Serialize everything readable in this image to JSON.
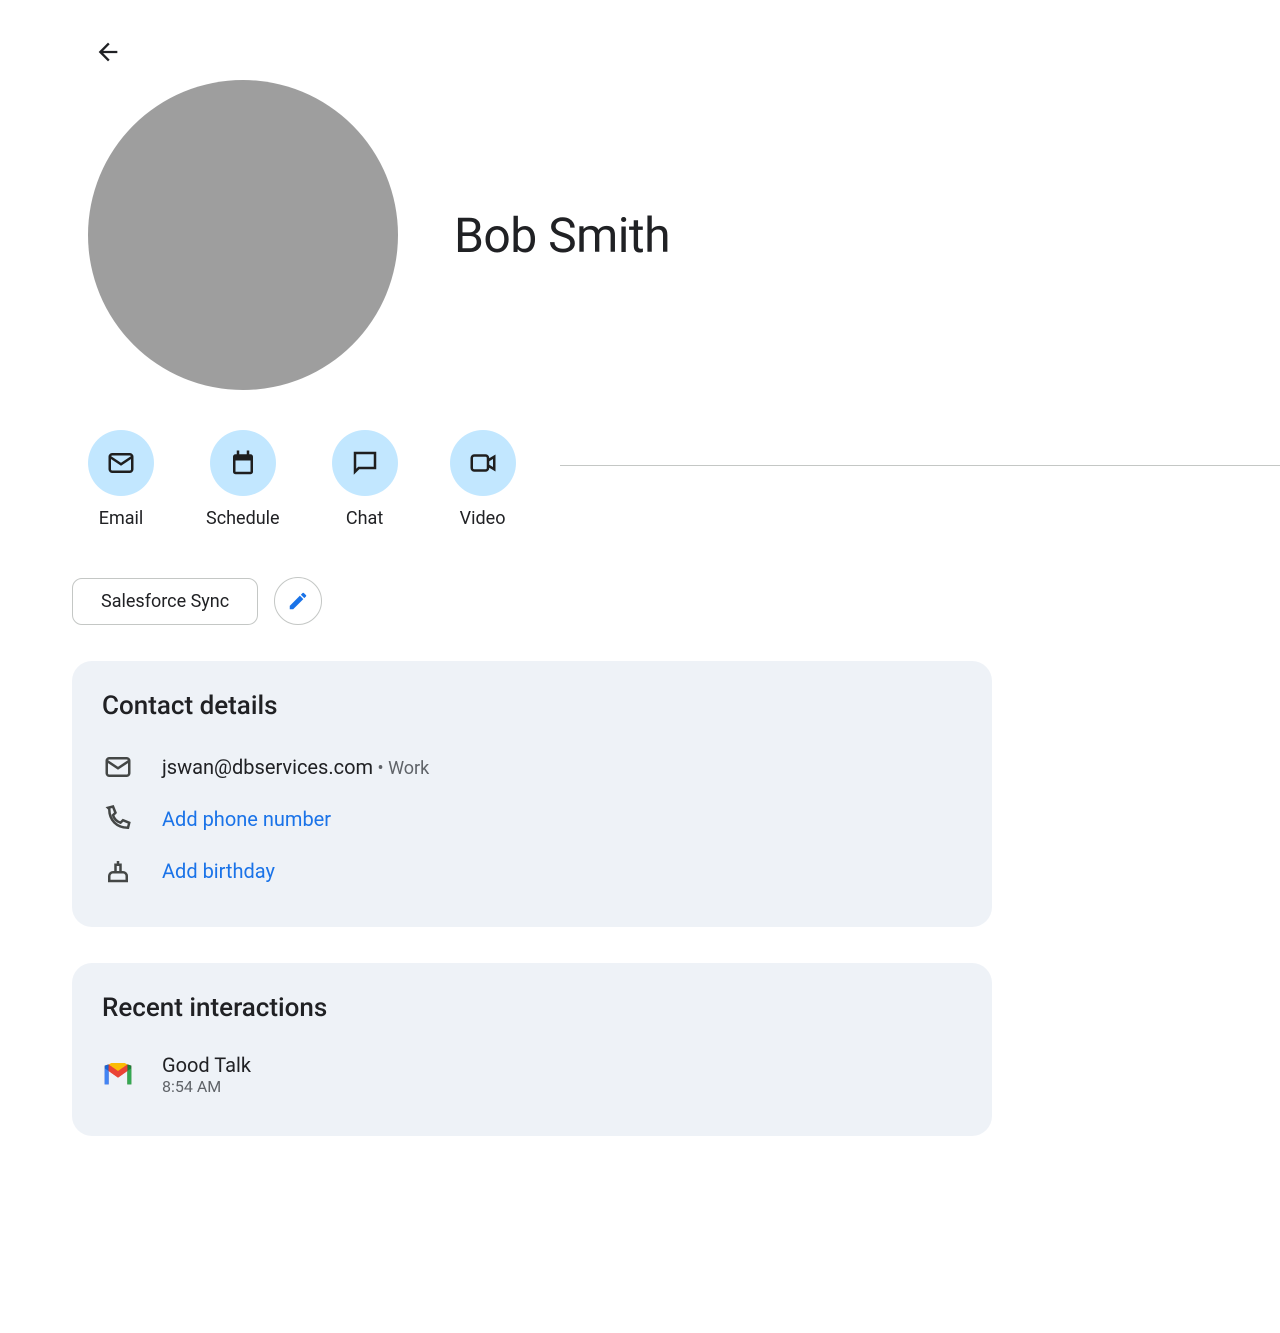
{
  "contact": {
    "name": "Bob Smith"
  },
  "actions": {
    "email": "Email",
    "schedule": "Schedule",
    "chat": "Chat",
    "video": "Video"
  },
  "tags": {
    "salesforce_sync": "Salesforce Sync"
  },
  "contact_details": {
    "title": "Contact details",
    "email": "jswan@dbservices.com",
    "email_type_separator": " • ",
    "email_type": "Work",
    "add_phone": "Add phone number",
    "add_birthday": "Add birthday"
  },
  "recent_interactions": {
    "title": "Recent interactions",
    "items": [
      {
        "title": "Good Talk",
        "time": "8:54 AM"
      }
    ]
  }
}
